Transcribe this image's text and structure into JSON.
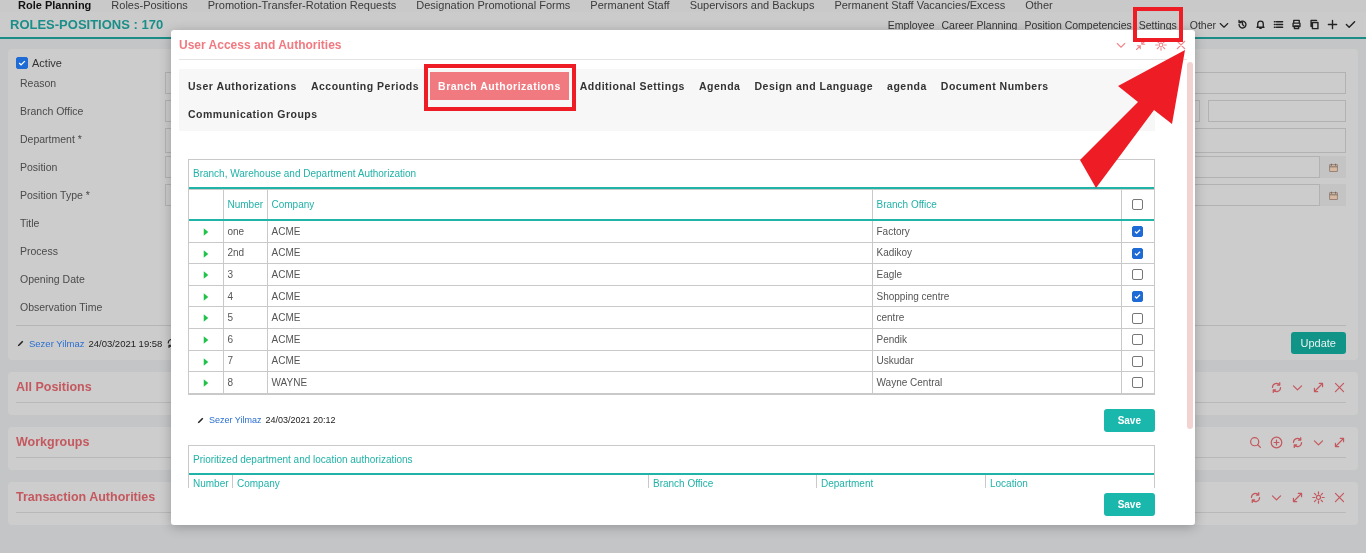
{
  "top_nav": [
    {
      "label": "Role Planning",
      "selected": true
    },
    {
      "label": "Roles-Positions",
      "selected": false
    },
    {
      "label": "Promotion-Transfer-Rotation Requests",
      "selected": false
    },
    {
      "label": "Designation Promotional Forms",
      "selected": false
    },
    {
      "label": "Permanent Staff",
      "selected": false
    },
    {
      "label": "Supervisors and Backups",
      "selected": false
    },
    {
      "label": "Permanent Staff Vacancies/Excess",
      "selected": false
    },
    {
      "label": "Other",
      "selected": false
    }
  ],
  "header": {
    "title": "ROLES-POSITIONS : 170",
    "links": [
      "Employee",
      "Career Planning",
      "Position Competencies",
      "Settings"
    ],
    "other_menu": "Other"
  },
  "form": {
    "active": {
      "label": "Active",
      "checked": true
    },
    "fields": [
      {
        "label": "Reason",
        "kind": "text"
      },
      {
        "label": "Branch Office",
        "kind": "split"
      },
      {
        "label": "Department *",
        "kind": "textarea"
      },
      {
        "label": "Position",
        "kind": "date"
      },
      {
        "label": "Position Type *",
        "kind": "date"
      },
      {
        "label": "Title",
        "kind": "none"
      },
      {
        "label": "Process",
        "kind": "none"
      },
      {
        "label": "Opening Date",
        "kind": "none"
      },
      {
        "label": "Observation Time",
        "kind": "none"
      }
    ],
    "author": "Sezer Yilmaz",
    "timestamp": "24/03/2021 19:58",
    "update_button": "Update"
  },
  "panels": [
    {
      "title": "All Positions",
      "tools": [
        {
          "kind": "refresh"
        },
        {
          "kind": "collapse"
        },
        {
          "kind": "expand"
        },
        {
          "kind": "close"
        }
      ]
    },
    {
      "title": "Workgroups",
      "tools": [
        {
          "kind": "search"
        },
        {
          "kind": "add"
        },
        {
          "kind": "refresh"
        },
        {
          "kind": "collapse"
        },
        {
          "kind": "expand"
        }
      ]
    },
    {
      "title": "Transaction Authorities",
      "tools": [
        {
          "kind": "refresh"
        },
        {
          "kind": "collapse"
        },
        {
          "kind": "expand"
        },
        {
          "kind": "settings"
        },
        {
          "kind": "close"
        }
      ]
    }
  ],
  "modal": {
    "title": "User Access and Authorities",
    "tabs": [
      {
        "label": "User Authorizations",
        "selected": false
      },
      {
        "label": "Accounting Periods",
        "selected": false
      },
      {
        "label": "Branch Authorizations",
        "selected": true
      },
      {
        "label": "Additional Settings",
        "selected": false
      },
      {
        "label": "Agenda",
        "selected": false
      },
      {
        "label": "Design and Language",
        "selected": false
      },
      {
        "label": "agenda",
        "selected": false
      },
      {
        "label": "Document Numbers",
        "selected": false
      },
      {
        "label": "Communication Groups",
        "selected": false
      }
    ],
    "section1": {
      "title": "Branch, Warehouse and Department Authorization",
      "columns": [
        "Number",
        "Company",
        "Branch Office"
      ],
      "all_checked": false,
      "rows": [
        {
          "number": "one",
          "company": "ACME",
          "branch": "Factory",
          "checked": true
        },
        {
          "number": "2nd",
          "company": "ACME",
          "branch": "Kadikoy",
          "checked": true
        },
        {
          "number": "3",
          "company": "ACME",
          "branch": "Eagle",
          "checked": false
        },
        {
          "number": "4",
          "company": "ACME",
          "branch": "Shopping centre",
          "checked": true
        },
        {
          "number": "5",
          "company": "ACME",
          "branch": "centre",
          "checked": false
        },
        {
          "number": "6",
          "company": "ACME",
          "branch": "Pendik",
          "checked": false
        },
        {
          "number": "7",
          "company": "ACME",
          "branch": "Uskudar",
          "checked": false
        },
        {
          "number": "8",
          "company": "WAYNE",
          "branch": "Wayne Central",
          "checked": false
        }
      ],
      "author": "Sezer Yilmaz",
      "timestamp": "24/03/2021 20:12",
      "save_button": "Save"
    },
    "section2": {
      "title": "Prioritized department and location authorizations",
      "columns": [
        "Number",
        "Company",
        "Branch Office",
        "Department",
        "Location"
      ]
    },
    "save_button": "Save"
  }
}
